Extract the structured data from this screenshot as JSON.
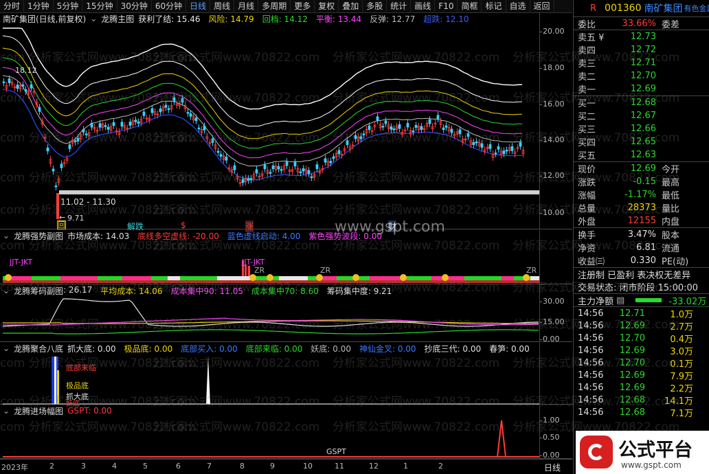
{
  "toolbar": {
    "items": [
      "分时",
      "1分钟",
      "5分钟",
      "15分钟",
      "30分钟",
      "60分钟",
      "日线",
      "周线",
      "月线",
      "多周期",
      "更多",
      "复权",
      "叠加",
      "多股",
      "统计",
      "画线",
      "F10",
      "简框",
      "标记",
      "自选",
      "返回"
    ],
    "active_index": 6
  },
  "main_chart": {
    "stock_label": "南矿集团(日线,前复权)",
    "indicator_name": "龙腾主图",
    "items": [
      {
        "label": "获利了结: 15.46",
        "color": "#e8e8e8"
      },
      {
        "label": "风险: 14.79",
        "color": "#f0d800"
      },
      {
        "label": "回档: 14.12",
        "color": "#2bd92b"
      },
      {
        "label": "平衡: 13.44",
        "color": "#ff44ff"
      },
      {
        "label": "反弹: 12.77",
        "color": "#bbbbbb"
      },
      {
        "label": "超跌: 12.10",
        "color": "#3a5aff"
      }
    ],
    "price_high_label": "18.12",
    "price_low_label": "9.71",
    "range_label": "11.02 - 11.30",
    "markers": [
      "回",
      "解跌",
      "$",
      "涨",
      "财"
    ],
    "axis_ticks": [
      "20.00",
      "18.00",
      "16.00",
      "14.00",
      "12.00",
      "10.00"
    ],
    "watermark_site": "www.gspt.com"
  },
  "panel_strength": {
    "name": "龙腾强势副图",
    "items": [
      {
        "label": "市场成本: 14.03",
        "color": "#e0e0e0"
      },
      {
        "label": "底线多空虚线: -20.00",
        "color": "#ff3b3b"
      },
      {
        "label": "蓝色虚线启动: 4.00",
        "color": "#3a7aff"
      },
      {
        "label": "紫色强势波段: 0.00",
        "color": "#ff44ff"
      }
    ],
    "signals": [
      "JJT-JKT",
      "JJT-JKT",
      "ZR",
      "ZR",
      "ZR"
    ]
  },
  "panel_chips": {
    "name": "龙腾筹码副图",
    "items": [
      {
        "label": ": 26.17",
        "color": "#e0e0e0"
      },
      {
        "label": "平均成本: 14.06",
        "color": "#f0d800"
      },
      {
        "label": "成本集中90: 11.05",
        "color": "#ff44ff"
      },
      {
        "label": "成本集中70: 8.60",
        "color": "#2bd92b"
      },
      {
        "label": "筹码集中度: 9.21",
        "color": "#e0e0e0"
      }
    ],
    "axis_ticks": [
      "30.00",
      "15.00",
      "0.00"
    ]
  },
  "panel_bottom8": {
    "name": "龙腾聚合八底",
    "items": [
      {
        "label": "抓大底: 0.00",
        "color": "#e0e0e0"
      },
      {
        "label": "极品底: 0.00",
        "color": "#f0d800"
      },
      {
        "label": "底部买入: 0.00",
        "color": "#3a7aff"
      },
      {
        "label": "底部来临: 0.00",
        "color": "#2bd92b"
      },
      {
        "label": "妖底: 0.00",
        "color": "#bbbbbb"
      },
      {
        "label": "神仙金叉: 0.00",
        "color": "#3a7aff"
      },
      {
        "label": "抄底三代: 0.00",
        "color": "#e0e0e0"
      },
      {
        "label": "春笋: 0.00",
        "color": "#e0e0e0"
      }
    ],
    "signal_labels": [
      "底部来临",
      "极品底",
      "抓大底",
      "妖底"
    ]
  },
  "panel_entry": {
    "name": "龙腾进场幅图",
    "items": [
      {
        "label": "GSPT: 0.00",
        "color": "#ff3b3b"
      }
    ],
    "axis_ticks": [
      "1.00",
      "0.50",
      "0.00"
    ],
    "x_labels": [
      "2023年",
      "2",
      "3",
      "4",
      "5",
      "6",
      "7",
      "8",
      "9",
      "10",
      "11",
      "12",
      "1",
      "2"
    ],
    "series_label": "GSPT",
    "period_label": "日线"
  },
  "quote": {
    "code": "001360",
    "name": "南矿集团",
    "tag": "有色金属",
    "weibi_label": "委比",
    "weibi_value": "33.66%",
    "weicha_label": "委差",
    "asks": [
      {
        "label": "卖五 ¥",
        "price": "12.73"
      },
      {
        "label": "卖四",
        "price": "12.72"
      },
      {
        "label": "卖三",
        "price": "12.71"
      },
      {
        "label": "卖二",
        "price": "12.70"
      },
      {
        "label": "卖一",
        "price": "12.69"
      }
    ],
    "bids": [
      {
        "label": "买一",
        "price": "12.68"
      },
      {
        "label": "买二",
        "price": "12.67"
      },
      {
        "label": "买三",
        "price": "12.66"
      },
      {
        "label": "买四",
        "price": "12.65"
      },
      {
        "label": "买五",
        "price": "12.63"
      }
    ],
    "stats": [
      {
        "label": "现价",
        "value": "12.69",
        "right": "今开",
        "color": "#2bd92b"
      },
      {
        "label": "涨跌",
        "value": "-0.15",
        "right": "最高",
        "color": "#2bd92b"
      },
      {
        "label": "涨幅",
        "value": "-1.17%",
        "right": "最低",
        "color": "#2bd92b"
      },
      {
        "label": "总量",
        "value": "28373",
        "right": "量比",
        "color": "#f0d800"
      },
      {
        "label": "外盘",
        "value": "12155",
        "right": "内盘",
        "color": "#ff3b3b"
      }
    ],
    "stats2": [
      {
        "label": "换手",
        "value": "3.47%",
        "right": "股本"
      },
      {
        "label": "净资",
        "value": "6.81",
        "right": "流通"
      },
      {
        "label": "收益㈢",
        "value": "0.330",
        "right": "PE(动)"
      }
    ],
    "status_line": "注册制 已盈利 表决权无差异",
    "phase_line": "交易状态: 闭市阶段 15:00:00",
    "main_flow_label": "主力净额",
    "main_flow_value": "-33.02万",
    "ticks": [
      {
        "time": "14:56",
        "price": "12.71",
        "vol": "1.0万",
        "color": "#2bd92b"
      },
      {
        "time": "14:56",
        "price": "12.69",
        "vol": "2.7万",
        "color": "#2bd92b"
      },
      {
        "time": "14:56",
        "price": "12.70",
        "vol": "0.4万",
        "color": "#2bd92b"
      },
      {
        "time": "14:56",
        "price": "12.69",
        "vol": "3.0万",
        "color": "#2bd92b"
      },
      {
        "time": "14:56",
        "price": "12.70",
        "vol": "0.1万",
        "color": "#2bd92b"
      },
      {
        "time": "14:56",
        "price": "12.69",
        "vol": "7.9万",
        "color": "#2bd92b"
      },
      {
        "time": "14:56",
        "price": "12.69",
        "vol": "2.2万",
        "color": "#2bd92b"
      },
      {
        "time": "14:56",
        "price": "12.68",
        "vol": "14.1万",
        "color": "#2bd92b"
      },
      {
        "time": "14:56",
        "price": "12.68",
        "vol": "7.1万",
        "color": "#2bd92b"
      }
    ]
  },
  "watermark": {
    "text": "分析家公式网www.70822.com",
    "text_short": "com",
    "logo_title": "公式平台",
    "logo_url": "www.gspt.com"
  }
}
